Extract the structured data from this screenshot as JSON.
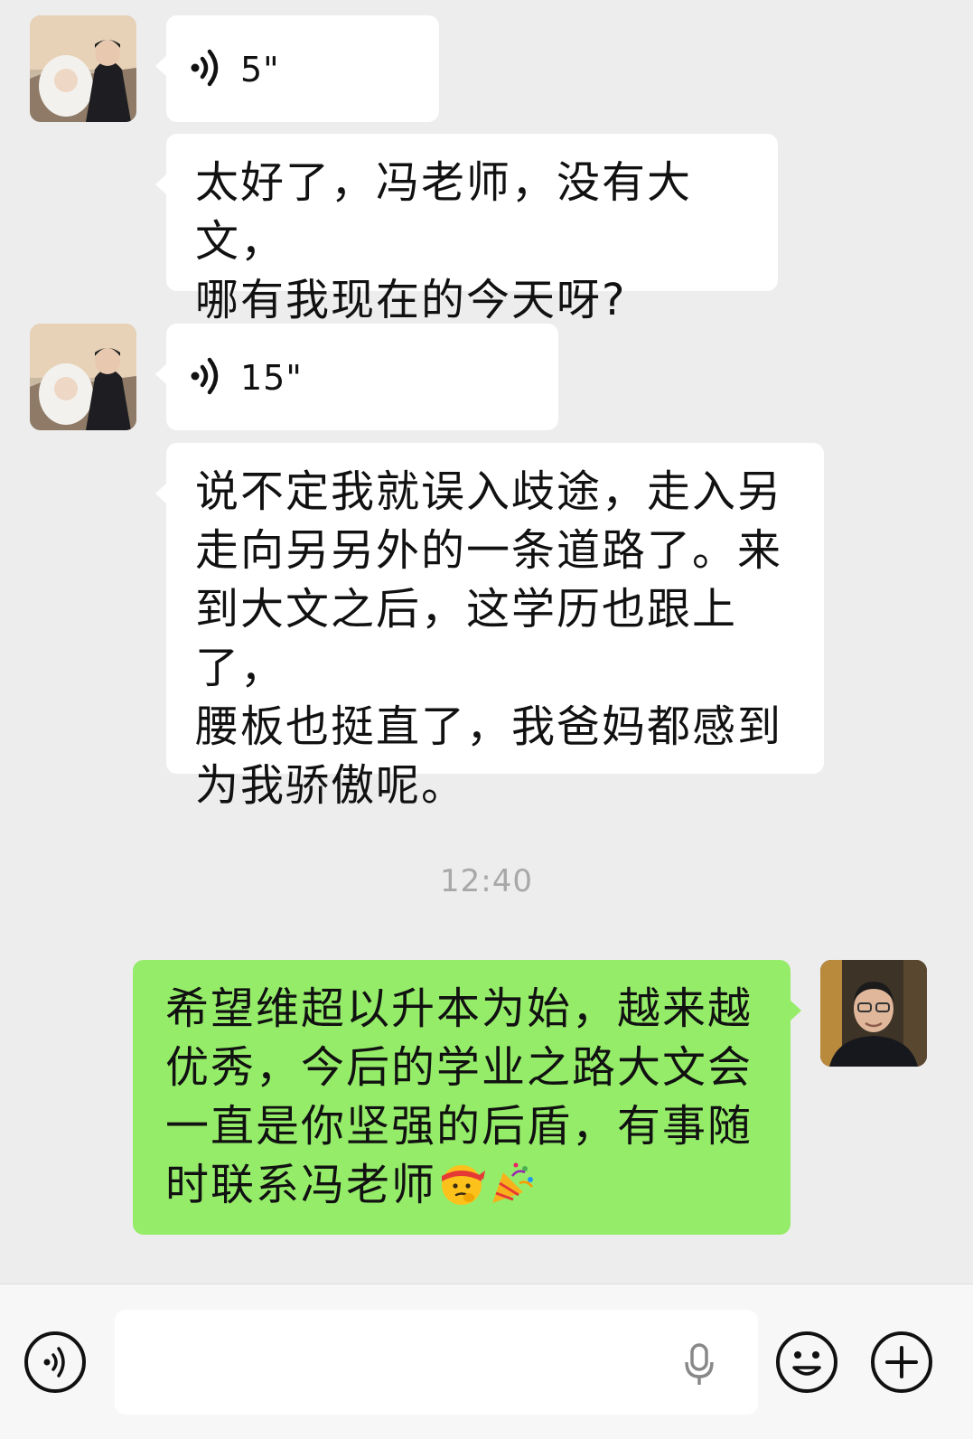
{
  "messages": [
    {
      "from": "contact",
      "type": "voice",
      "duration": "5\""
    },
    {
      "from": "contact",
      "type": "text",
      "text": "太好了，冯老师，没有大文，\n哪有我现在的今天呀?"
    },
    {
      "from": "contact",
      "type": "voice",
      "duration": "15\""
    },
    {
      "from": "contact",
      "type": "text",
      "text": "说不定我就误入歧途，走入另\n走向另另外的一条道路了。来\n到大文之后，这学历也跟上了，\n腰板也挺直了，我爸妈都感到\n为我骄傲呢。"
    },
    {
      "from": "me",
      "type": "text",
      "text": "希望维超以升本为始，越来越\n优秀，今后的学业之路大文会\n一直是你坚强的后盾，有事随\n时联系冯老师",
      "emojis": [
        "thinking-headband-emoji",
        "party-popper-emoji"
      ]
    }
  ],
  "timestamp": "12:40",
  "input": {
    "value": "",
    "placeholder": ""
  },
  "icons": {
    "voice_toggle": "voice-mode-icon",
    "mic": "microphone-icon",
    "emoji": "emoji-icon",
    "more": "plus-icon"
  },
  "colors": {
    "background": "#ededed",
    "bubble_incoming": "#ffffff",
    "bubble_outgoing": "#95ec69",
    "timestamp": "#a8a8a8"
  }
}
